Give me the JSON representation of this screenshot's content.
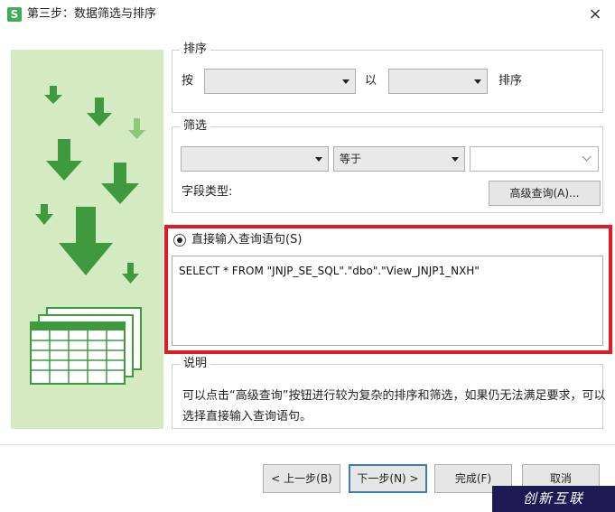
{
  "window": {
    "app_icon": "S",
    "title": "第三步：数据筛选与排序",
    "close_label": "×"
  },
  "sort_group": {
    "title": "排序",
    "by_label": "按",
    "field_value": "",
    "with_label": "以",
    "order_value": "",
    "suffix_label": "排序"
  },
  "filter_group": {
    "title": "筛选",
    "field_value": "",
    "operator_value": "等于",
    "value_value": "",
    "field_type_label": "字段类型:",
    "advanced_button": "高级查询(A)..."
  },
  "direct_query": {
    "radio_label": "直接输入查询语句(S)",
    "checked": true,
    "sql": "SELECT * FROM \"JNJP_SE_SQL\".\"dbo\".\"View_JNJP1_NXH\"",
    "highlight_color": "#e01b24"
  },
  "description": {
    "title": "说明",
    "text": "可以点击“高级查询”按钮进行较为复杂的排序和筛选，如果仍无法满足要求，可以选择直接输入查询语句。"
  },
  "footer": {
    "back_button": "< 上一步(B)",
    "next_button": "下一步(N) >",
    "finish_button": "完成(F)",
    "cancel_button": "取消"
  },
  "watermark": {
    "text": "创新互联"
  },
  "colors": {
    "illustration_bg": "#d4ebc1",
    "arrow_green": "#3f9a3f",
    "arrow_light_green": "#8cc97a"
  },
  "icons": [
    "app-logo-icon",
    "close-icon",
    "down-arrow-icon",
    "spreadsheet-icon",
    "chevron-down-icon"
  ]
}
